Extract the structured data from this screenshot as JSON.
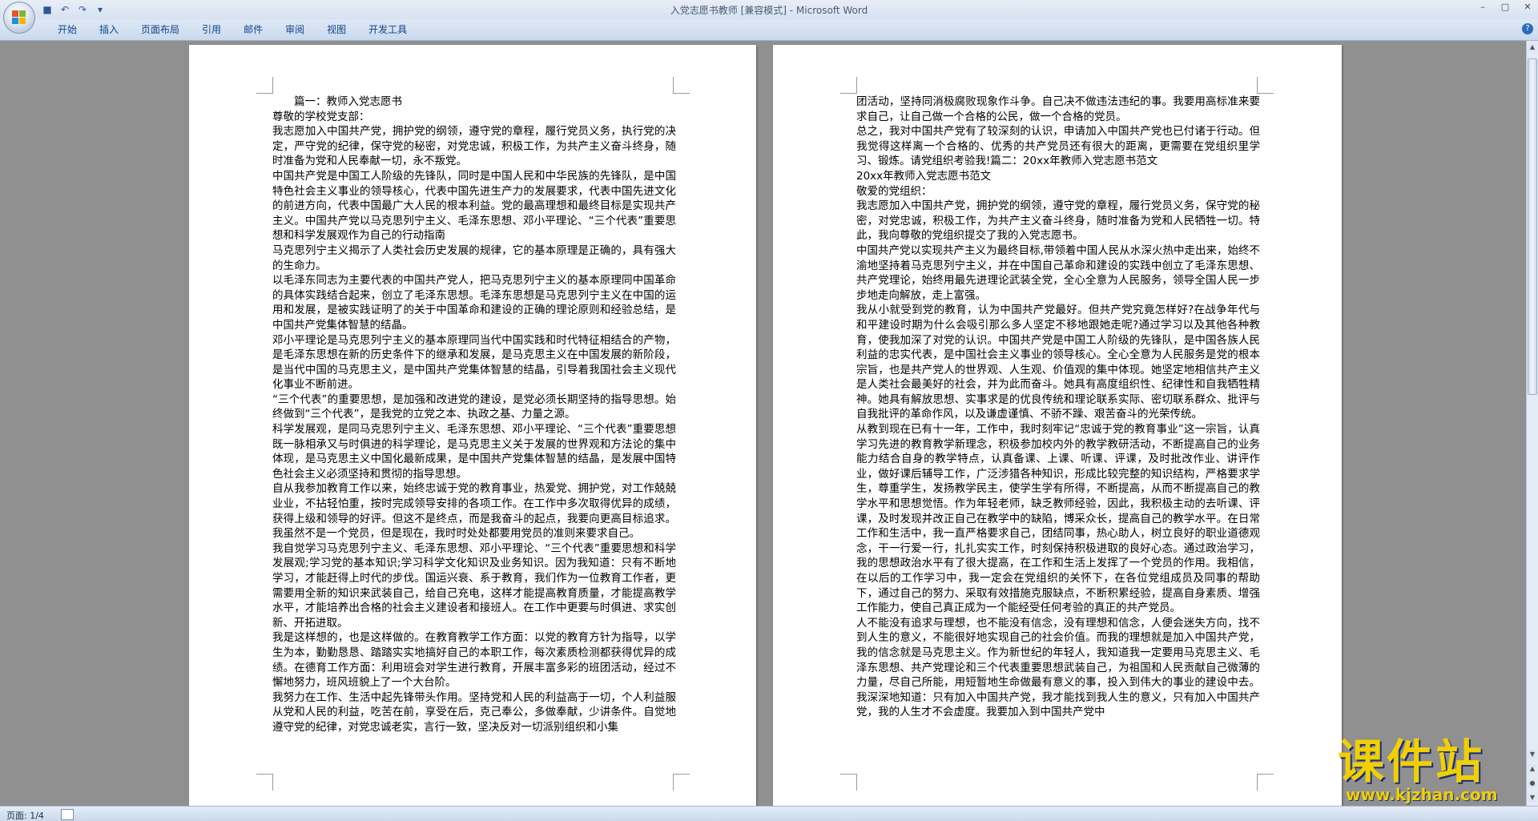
{
  "window": {
    "title": "入党志愿书教师 [兼容模式] - Microsoft Word"
  },
  "quick_access": {
    "save_icon": "save-icon",
    "undo_icon": "undo-icon",
    "redo_icon": "redo-icon",
    "customize_icon": "chevron-down-icon"
  },
  "ribbon": {
    "tabs": [
      "开始",
      "插入",
      "页面布局",
      "引用",
      "邮件",
      "审阅",
      "视图",
      "开发工具"
    ]
  },
  "status": {
    "page_count": "页面: 1/4"
  },
  "watermark": {
    "text": "课件站",
    "url": "www.kjzhan.com"
  },
  "pages": [
    {
      "paragraphs": [
        "　　篇一：教师入党志愿书",
        "尊敬的学校党支部：",
        "我志愿加入中国共产党，拥护党的纲领，遵守党的章程，履行党员义务，执行党的决定，严守党的纪律，保守党的秘密，对党忠诚，积极工作，为共产主义奋斗终身，随时准备为党和人民奉献一切，永不叛党。",
        "中国共产党是中国工人阶级的先锋队，同时是中国人民和中华民族的先锋队，是中国特色社会主义事业的领导核心，代表中国先进生产力的发展要求，代表中国先进文化的前进方向，代表中国最广大人民的根本利益。党的最高理想和最终目标是实现共产主义。中国共产党以马克思列宁主义、毛泽东思想、邓小平理论、“三个代表”重要思想和科学发展观作为自己的行动指南",
        "马克思列宁主义揭示了人类社会历史发展的规律，它的基本原理是正确的，具有强大的生命力。",
        "以毛泽东同志为主要代表的中国共产党人，把马克思列宁主义的基本原理同中国革命的具体实践结合起来，创立了毛泽东思想。毛泽东思想是马克思列宁主义在中国的运用和发展，是被实践证明了的关于中国革命和建设的正确的理论原则和经验总结，是中国共产党集体智慧的结晶。",
        "邓小平理论是马克思列宁主义的基本原理同当代中国实践和时代特征相结合的产物，是毛泽东思想在新的历史条件下的继承和发展，是马克思主义在中国发展的新阶段，是当代中国的马克思主义，是中国共产党集体智慧的结晶，引导着我国社会主义现代化事业不断前进。",
        "“三个代表”的重要思想，是加强和改进党的建设，是党必须长期坚持的指导思想。始终做到“三个代表”，是我党的立党之本、执政之基、力量之源。",
        "科学发展观，是同马克思列宁主义、毛泽东思想、邓小平理论、“三个代表”重要思想既一脉相承又与时俱进的科学理论，是马克思主义关于发展的世界观和方法论的集中体现，是马克思主义中国化最新成果，是中国共产党集体智慧的结晶，是发展中国特色社会主义必须坚持和贯彻的指导思想。",
        "自从我参加教育工作以来，始终忠诚于党的教育事业，热爱党、拥护党，对工作兢兢业业，不拈轻怕重，按时完成领导安排的各项工作。在工作中多次取得优异的成绩，获得上级和领导的好评。但这不是终点，而是我奋斗的起点，我要向更高目标追求。我虽然不是一个党员，但是现在，我时时处处都要用党员的准则来要求自己。",
        "我自觉学习马克思列宁主义、毛泽东思想、邓小平理论、“三个代表”重要思想和科学发展观;学习党的基本知识;学习科学文化知识及业务知识。因为我知道：只有不断地学习，才能赶得上时代的步伐。国运兴衰、系于教育，我们作为一位教育工作者，更需要用全新的知识来武装自己，给自己充电，这样才能提高教育质量，才能提高教学水平，才能培养出合格的社会主义建设者和接班人。在工作中更要与时俱进、求实创新、开拓进取。",
        "我是这样想的，也是这样做的。在教育教学工作方面：以党的教育方针为指导，以学生为本，勤勤恳恳、踏踏实实地搞好自己的本职工作，每次素质检测都获得优异的成绩。在德育工作方面：利用班会对学生进行教育，开展丰富多彩的班团活动，经过不懈地努力，班风班貌上了一个大台阶。",
        "我努力在工作、生活中起先锋带头作用。坚持党和人民的利益高于一切，个人利益服从党和人民的利益，吃苦在前，享受在后，克己奉公，多做奉献，少讲条件。自觉地遵守党的纪律，对党忠诚老实，言行一致，坚决反对一切派别组织和小集"
      ]
    },
    {
      "paragraphs": [
        "团活动，坚持同消极腐败现象作斗争。自己决不做违法违纪的事。我要用高标准来要求自己，让自己做一个合格的公民，做一个合格的党员。",
        "总之，我对中国共产党有了较深刻的认识，申请加入中国共产党也已付诸于行动。但我觉得这样离一个合格的、优秀的共产党员还有很大的距离，更需要在党组织里学习、锻炼。请党组织考验我!篇二：20xx年教师入党志愿书范文",
        "20xx年教师入党志愿书范文",
        "敬爱的党组织：",
        "我志愿加入中国共产党，拥护党的纲领，遵守党的章程，履行党员义务，保守党的秘密，对党忠诚，积极工作，为共产主义奋斗终身，随时准备为党和人民牺牲一切。特此，我向尊敬的党组织提交了我的入党志愿书。",
        "中国共产党以实现共产主义为最终目标,带领着中国人民从水深火热中走出来，始终不渝地坚持着马克思列宁主义，并在中国自己革命和建设的实践中创立了毛泽东思想、共产党理论，始终用最先进理论武装全党，全心全意为人民服务，领导全国人民一步步地走向解放，走上富强。",
        "我从小就受到党的教育，认为中国共产党最好。但共产党究竟怎样好?在战争年代与和平建设时期为什么会吸引那么多人坚定不移地跟她走呢?通过学习以及其他各种教育，使我加深了对党的认识。中国共产党是中国工人阶级的先锋队，是中国各族人民利益的忠实代表，是中国社会主义事业的领导核心。全心全意为人民服务是党的根本宗旨，也是共产党人的世界观、人生观、价值观的集中体现。她坚定地相信共产主义是人类社会最美好的社会，并为此而奋斗。她具有高度组织性、纪律性和自我牺牲精神。她具有解放思想、实事求是的优良传统和理论联系实际、密切联系群众、批评与自我批评的革命作风，以及谦虚谨慎、不骄不躁、艰苦奋斗的光荣传统。",
        "从教到现在已有十一年，工作中，我时刻牢记“忠诚于党的教育事业”这一宗旨，认真学习先进的教育教学新理念，积极参加校内外的教学教研活动，不断提高自己的业务能力结合自身的教学特点，认真备课、上课、听课、评课，及时批改作业、讲评作业，做好课后辅导工作，广泛涉猎各种知识，形成比较完整的知识结构，严格要求学生，尊重学生，发扬教学民主，使学生学有所得，不断提高，从而不断提高自己的教学水平和思想觉悟。作为年轻老师，缺乏教师经验，因此，我积极主动的去听课、评课，及时发现并改正自己在教学中的缺陷，博采众长，提高自己的教学水平。在日常工作和生活中，我一直严格要求自己，团结同事，热心助人，树立良好的职业道德观念，干一行爱一行，扎扎实实工作，时刻保持积极进取的良好心态。通过政治学习，我的思想政治水平有了很大提高，在工作和生活上发挥了一个党员的作用。我相信，在以后的工作学习中，我一定会在党组织的关怀下，在各位党组成员及同事的帮助下，通过自己的努力、采取有效措施克服缺点，不断积累经验，提高自身素质、增强工作能力，使自己真正成为一个能经受任何考验的真正的共产党员。",
        "人不能没有追求与理想，也不能没有信念，没有理想和信念，人便会迷失方向，找不到人生的意义，不能很好地实现自己的社会价值。而我的理想就是加入中国共产党，我的信念就是马克思主义。作为新世纪的年轻人，我知道我一定要用马克思主义、毛泽东思想、共产党理论和三个代表重要思想武装自己，为祖国和人民贡献自己微薄的力量，尽自己所能，用短暂地生命做最有意义的事，投入到伟大的事业的建设中去。我深深地知道：只有加入中国共产党，我才能找到我人生的意义，只有加入中国共产党，我的人生才不会虚度。我要加入到中国共产党中"
      ]
    }
  ]
}
